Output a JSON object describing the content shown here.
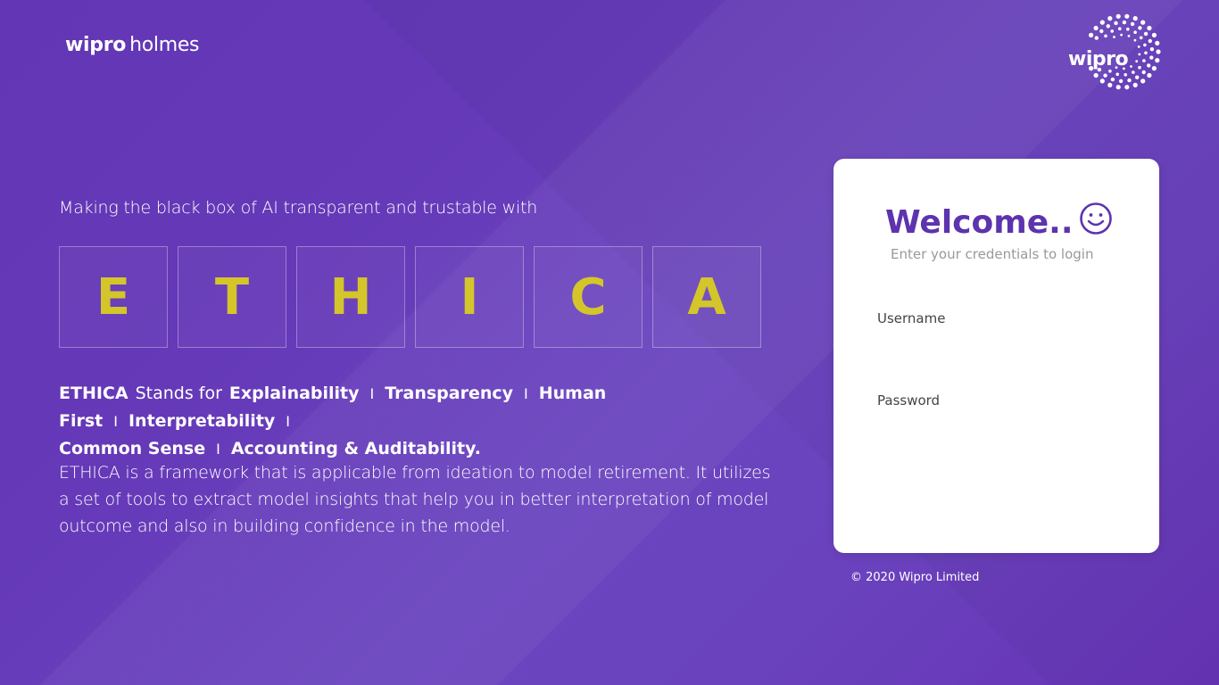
{
  "header": {
    "brand_left_bold": "wipro",
    "brand_left_light": "holmes",
    "brand_right": "wipro"
  },
  "hero": {
    "tagline": "Making the black box of AI transparent and trustable with",
    "letters": [
      "E",
      "T",
      "H",
      "I",
      "C",
      "A"
    ],
    "stands": {
      "name": "ETHICA",
      "connector": "Stands for",
      "terms": [
        "Explainability",
        "Transparency",
        "Human First",
        "Interpretability",
        "Common Sense",
        "Accounting & Auditability."
      ],
      "separator": "I"
    },
    "description": "ETHICA is a framework that is applicable from ideation to model retirement. It utilizes a set of tools to extract model insights that help you in better interpretation of model outcome and also in building confidence in the model."
  },
  "login": {
    "title": "Welcome..",
    "subtitle": "Enter your credentials to login",
    "username_label": "Username",
    "username_value": "",
    "password_label": "Password",
    "password_value": ""
  },
  "footer": {
    "copyright": "© 2020 Wipro Limited"
  },
  "colors": {
    "background": "#6539b8",
    "accent_letters": "#d4c52a",
    "title_purple": "#5d33ae",
    "card": "#ffffff"
  }
}
